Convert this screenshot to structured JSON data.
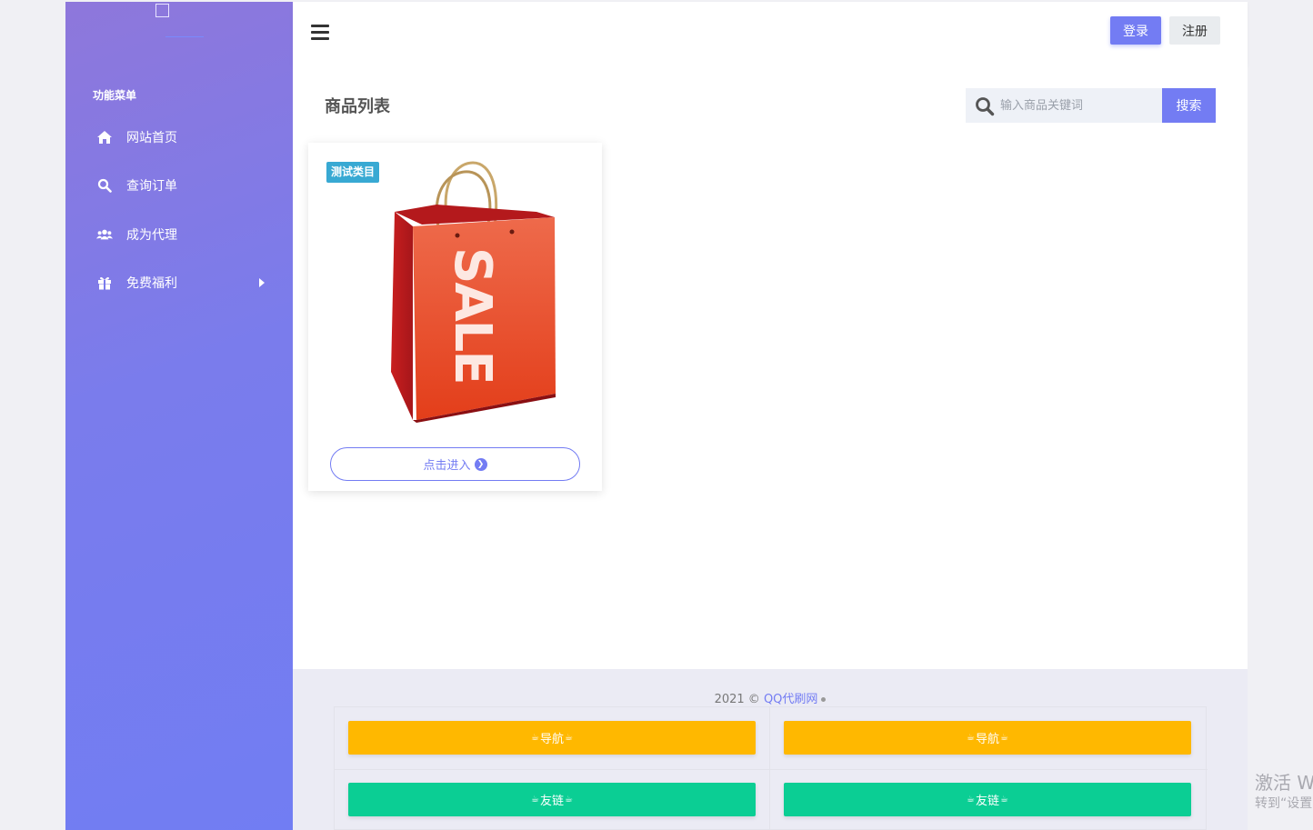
{
  "sidebar": {
    "menu_heading": "功能菜单",
    "items": [
      {
        "label": "网站首页",
        "icon": "home-icon"
      },
      {
        "label": "查询订单",
        "icon": "search-icon"
      },
      {
        "label": "成为代理",
        "icon": "users-icon"
      },
      {
        "label": "免费福利",
        "icon": "gift-icon",
        "has_submenu": true
      }
    ]
  },
  "header": {
    "login_label": "登录",
    "register_label": "注册"
  },
  "main": {
    "title": "商品列表",
    "search": {
      "placeholder": "输入商品关键词",
      "button_label": "搜索"
    },
    "products": [
      {
        "tag": "测试类目",
        "image_text": "SALE",
        "button_label": "点击进入"
      }
    ]
  },
  "footer": {
    "copyright_prefix": "2021 © ",
    "site_name": "QQ代刷网",
    "buttons": [
      {
        "label": "导航",
        "type": "nav"
      },
      {
        "label": "导航",
        "type": "nav"
      },
      {
        "label": "友链",
        "type": "friend"
      },
      {
        "label": "友链",
        "type": "friend"
      }
    ]
  },
  "watermark": {
    "line1": "激活 W",
    "line2": "转到“设置"
  },
  "colors": {
    "accent": "#737cf3",
    "nav_button": "#ffb800",
    "friend_button": "#0bce94",
    "tag": "#38a9d3"
  }
}
